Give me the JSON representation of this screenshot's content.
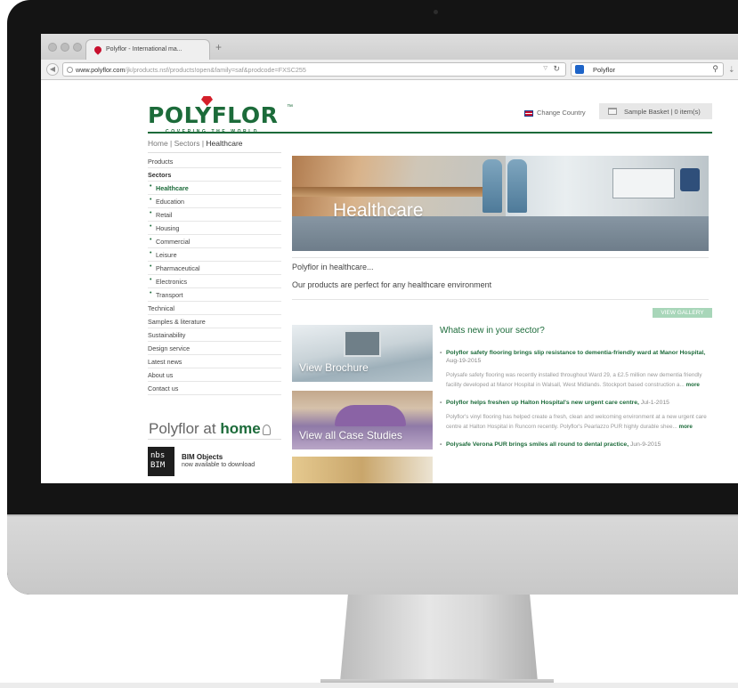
{
  "browser": {
    "tab_title": "Polyflor - International ma...",
    "new_tab": "+",
    "url_host": "www.polyflor.com",
    "url_path": "/jk/products.nsf/products!open&family=saf&prodcode=FXSC255",
    "search_text": "Polyflor"
  },
  "header": {
    "logo_word": "POLYFLOR",
    "logo_tm": "™",
    "logo_tagline": "COVERING THE WORLD",
    "change_country": "Change Country",
    "basket": "Sample Basket | 0 item(s)"
  },
  "breadcrumb": {
    "home": "Home",
    "sep1": " | ",
    "sectors": "Sectors",
    "sep2": " | ",
    "current": "Healthcare"
  },
  "sidebar": {
    "items": [
      {
        "label": "Products"
      },
      {
        "label": "Sectors"
      },
      {
        "label": "Healthcare"
      },
      {
        "label": "Education"
      },
      {
        "label": "Retail"
      },
      {
        "label": "Housing"
      },
      {
        "label": "Commercial"
      },
      {
        "label": "Leisure"
      },
      {
        "label": "Pharmaceutical"
      },
      {
        "label": "Electronics"
      },
      {
        "label": "Transport"
      },
      {
        "label": "Technical"
      },
      {
        "label": "Samples & literature"
      },
      {
        "label": "Sustainability"
      },
      {
        "label": "Design service"
      },
      {
        "label": "Latest news"
      },
      {
        "label": "About us"
      },
      {
        "label": "Contact us"
      }
    ],
    "at_home_prefix": "Polyflor",
    "at_home_word": "at",
    "at_home_suffix": "home",
    "bim_logo_line1": "nbs",
    "bim_logo_line2": "BIM",
    "bim_title": "BIM Objects",
    "bim_sub": "now available to download"
  },
  "main": {
    "hero_title": "Healthcare",
    "intro1": "Polyflor in healthcare...",
    "intro2": "Our products are perfect for any healthcare environment",
    "gallery_button": "VIEW GALLERY",
    "tiles": [
      {
        "caption": "View Brochure"
      },
      {
        "caption": "View all Case Studies"
      }
    ],
    "news_heading": "Whats new in your sector?",
    "news": [
      {
        "title": "Polyflor safety flooring brings slip resistance to dementia-friendly ward at Manor Hospital,",
        "date": "Aug-19-2015",
        "body": "Polysafe safety flooring was recently installed throughout Ward 29, a £2.5 million new dementia friendly facility developed at Manor Hospital in Walsall, West Midlands. Stockport based construction a...",
        "more": "more"
      },
      {
        "title": "Polyflor helps freshen up Halton Hospital's new urgent care centre,",
        "date": "Jul-1-2015",
        "body": "Polyflor's vinyl flooring has helped create a fresh, clean and welcoming environment at a new urgent care centre at Halton Hospital in Runcorn recently. Polyflor's Pearlazzo PUR highly durable shee...",
        "more": "more"
      },
      {
        "title": "Polysafe Verona PUR brings smiles all round to dental practice,",
        "date": "Jun-9-2015",
        "body": "",
        "more": ""
      }
    ]
  },
  "colors": {
    "brand_green": "#1c6b3a",
    "logo_red": "#d41f2a",
    "gallery_button": "#a8d6b9"
  }
}
